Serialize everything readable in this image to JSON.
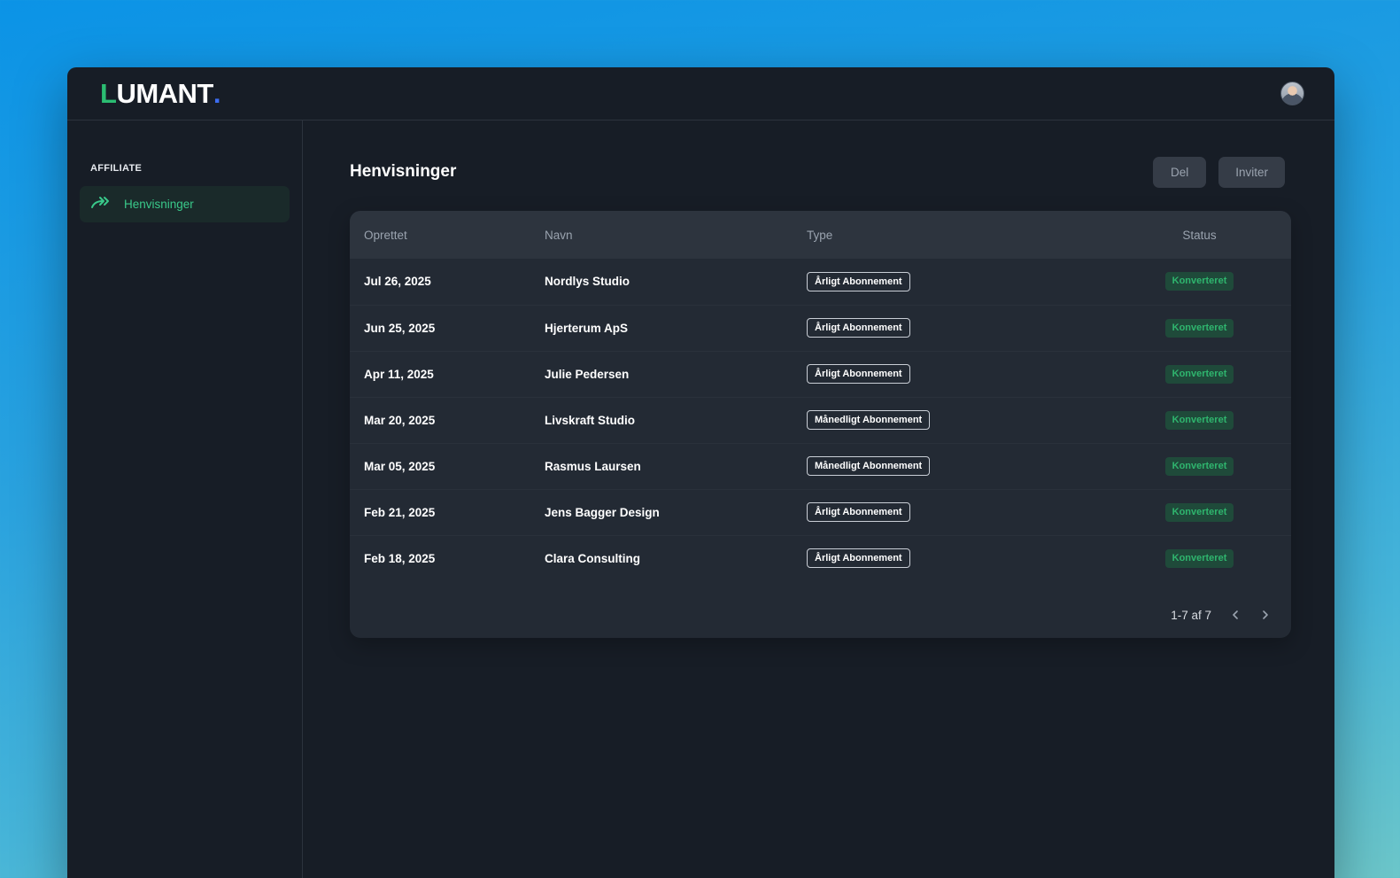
{
  "app": {
    "logo_first": "L",
    "logo_rest": "UMANT",
    "logo_dot": "."
  },
  "sidebar": {
    "section_label": "AFFILIATE",
    "items": [
      {
        "label": "Henvisninger",
        "icon": "double-arrow-icon",
        "active": true
      }
    ]
  },
  "main": {
    "title": "Henvisninger",
    "buttons": {
      "share": "Del",
      "invite": "Inviter"
    }
  },
  "table": {
    "columns": [
      "Oprettet",
      "Navn",
      "Type",
      "Status"
    ],
    "rows": [
      {
        "created": "Jul 26, 2025",
        "name": "Nordlys Studio",
        "type": "Årligt Abonnement",
        "status": "Konverteret"
      },
      {
        "created": "Jun 25, 2025",
        "name": "Hjerterum ApS",
        "type": "Årligt Abonnement",
        "status": "Konverteret"
      },
      {
        "created": "Apr 11, 2025",
        "name": "Julie Pedersen",
        "type": "Årligt Abonnement",
        "status": "Konverteret"
      },
      {
        "created": "Mar 20, 2025",
        "name": "Livskraft Studio",
        "type": "Månedligt Abonnement",
        "status": "Konverteret"
      },
      {
        "created": "Mar 05, 2025",
        "name": "Rasmus Laursen",
        "type": "Månedligt Abonnement",
        "status": "Konverteret"
      },
      {
        "created": "Feb 21, 2025",
        "name": "Jens Bagger Design",
        "type": "Årligt Abonnement",
        "status": "Konverteret"
      },
      {
        "created": "Feb 18, 2025",
        "name": "Clara Consulting",
        "type": "Årligt Abonnement",
        "status": "Konverteret"
      }
    ]
  },
  "pagination": {
    "range": "1-7 af 7"
  },
  "colors": {
    "accent_green": "#2bbd72",
    "logo_dot_blue": "#3c6cf0",
    "background": "#171d26",
    "status_bg": "#1f4a3a"
  }
}
